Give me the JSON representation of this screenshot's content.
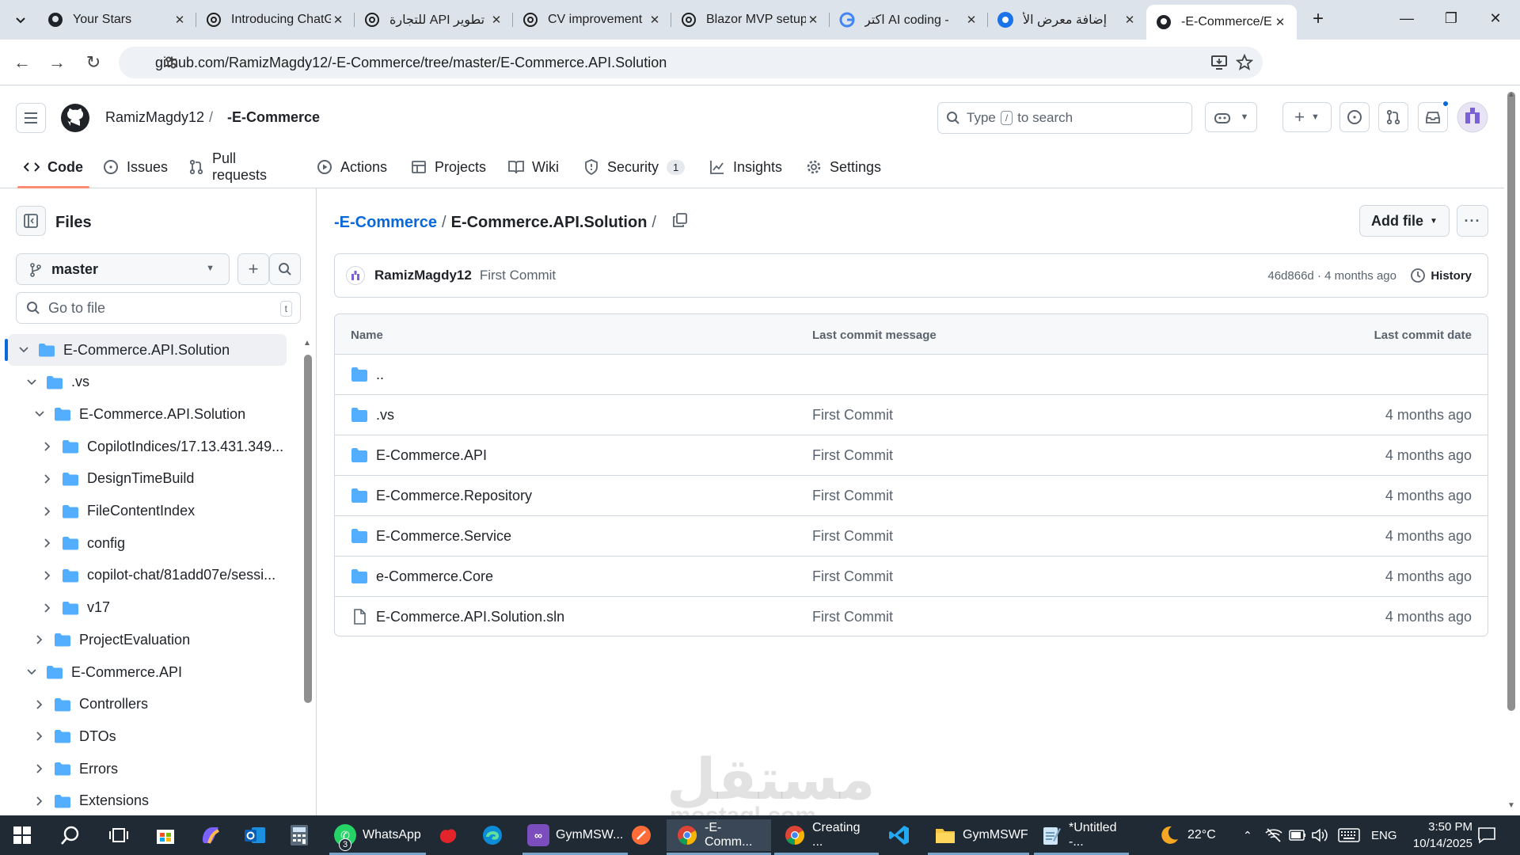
{
  "browser": {
    "tabs": [
      {
        "title": "Your Stars",
        "icon": "github-icon"
      },
      {
        "title": "Introducing ChatGPT",
        "icon": "chatgpt-icon"
      },
      {
        "title": "تطوير API للتجارة",
        "icon": "chatgpt-icon"
      },
      {
        "title": "CV improvement",
        "icon": "chatgpt-icon"
      },
      {
        "title": "Blazor MVP setup",
        "icon": "chatgpt-icon"
      },
      {
        "title": "اكتر AI coding -",
        "icon": "google-icon"
      },
      {
        "title": "إضافة معرض الأ",
        "icon": "blue-circle-icon"
      },
      {
        "title": "-E-Commerce/E",
        "icon": "github-icon",
        "active": true
      }
    ],
    "url": "github.com/RamizMagdy12/-E-Commerce/tree/master/E-Commerce.API.Solution"
  },
  "github": {
    "owner": "RamizMagdy12",
    "slash": "/",
    "repo": "-E-Commerce",
    "search_prefix": "Type",
    "search_key": "/",
    "search_suffix": "to search",
    "nav": [
      {
        "label": "Code",
        "icon": "code-icon",
        "selected": true
      },
      {
        "label": "Issues",
        "icon": "issue-icon"
      },
      {
        "label": "Pull requests",
        "icon": "pull-request-icon"
      },
      {
        "label": "Actions",
        "icon": "play-icon"
      },
      {
        "label": "Projects",
        "icon": "table-icon"
      },
      {
        "label": "Wiki",
        "icon": "book-icon"
      },
      {
        "label": "Security",
        "icon": "shield-icon",
        "count": "1"
      },
      {
        "label": "Insights",
        "icon": "graph-icon"
      },
      {
        "label": "Settings",
        "icon": "gear-icon"
      }
    ]
  },
  "sidebar": {
    "title": "Files",
    "branch": "master",
    "goto_placeholder": "Go to file",
    "goto_key": "t",
    "tree": [
      {
        "label": "E-Commerce.API.Solution",
        "depth": 0,
        "expanded": true,
        "selected": true
      },
      {
        "label": ".vs",
        "depth": 1,
        "expanded": true
      },
      {
        "label": "E-Commerce.API.Solution",
        "depth": 2,
        "expanded": true
      },
      {
        "label": "CopilotIndices/17.13.431.349...",
        "depth": 3,
        "expanded": false
      },
      {
        "label": "DesignTimeBuild",
        "depth": 3,
        "expanded": false
      },
      {
        "label": "FileContentIndex",
        "depth": 3,
        "expanded": false
      },
      {
        "label": "config",
        "depth": 3,
        "expanded": false
      },
      {
        "label": "copilot-chat/81add07e/sessi...",
        "depth": 3,
        "expanded": false
      },
      {
        "label": "v17",
        "depth": 3,
        "expanded": false
      },
      {
        "label": "ProjectEvaluation",
        "depth": 2,
        "expanded": false
      },
      {
        "label": "E-Commerce.API",
        "depth": 1,
        "expanded": true
      },
      {
        "label": "Controllers",
        "depth": 2,
        "expanded": false
      },
      {
        "label": "DTOs",
        "depth": 2,
        "expanded": false
      },
      {
        "label": "Errors",
        "depth": 2,
        "expanded": false
      },
      {
        "label": "Extensions",
        "depth": 2,
        "expanded": false
      }
    ]
  },
  "main": {
    "breadcrumb_repo": "-E-Commerce",
    "breadcrumb_sep": "/",
    "breadcrumb_current": "E-Commerce.API.Solution",
    "add_file": "Add file",
    "commit": {
      "author": "RamizMagdy12",
      "message": "First Commit",
      "meta": "46d866d · 4 months ago",
      "history": "History"
    },
    "columns": {
      "name": "Name",
      "message": "Last commit message",
      "date": "Last commit date"
    },
    "parent_label": "..",
    "files": [
      {
        "name": ".vs",
        "type": "folder",
        "message": "First Commit",
        "date": "4 months ago"
      },
      {
        "name": "E-Commerce.API",
        "type": "folder",
        "message": "First Commit",
        "date": "4 months ago"
      },
      {
        "name": "E-Commerce.Repository",
        "type": "folder",
        "message": "First Commit",
        "date": "4 months ago"
      },
      {
        "name": "E-Commerce.Service",
        "type": "folder",
        "message": "First Commit",
        "date": "4 months ago"
      },
      {
        "name": "e-Commerce.Core",
        "type": "folder",
        "message": "First Commit",
        "date": "4 months ago"
      },
      {
        "name": "E-Commerce.API.Solution.sln",
        "type": "file",
        "message": "First Commit",
        "date": "4 months ago"
      }
    ]
  },
  "watermark": {
    "arabic": "مستقل",
    "latin": "mostaql.com"
  },
  "taskbar": {
    "apps": [
      {
        "label": "WhatsApp",
        "badge": "3"
      },
      {
        "label": "GymMSW..."
      },
      {
        "label": "-E-Comm..."
      },
      {
        "label": "Creating ..."
      },
      {
        "label": "GymMSWF"
      },
      {
        "label": "*Untitled -..."
      }
    ],
    "temperature": "22°C",
    "language": "ENG",
    "time": "3:50 PM",
    "date": "10/14/2025"
  },
  "colors": {
    "accent": "#0969da",
    "tab_underline": "#fd8c73",
    "folder": "#54aeff"
  }
}
